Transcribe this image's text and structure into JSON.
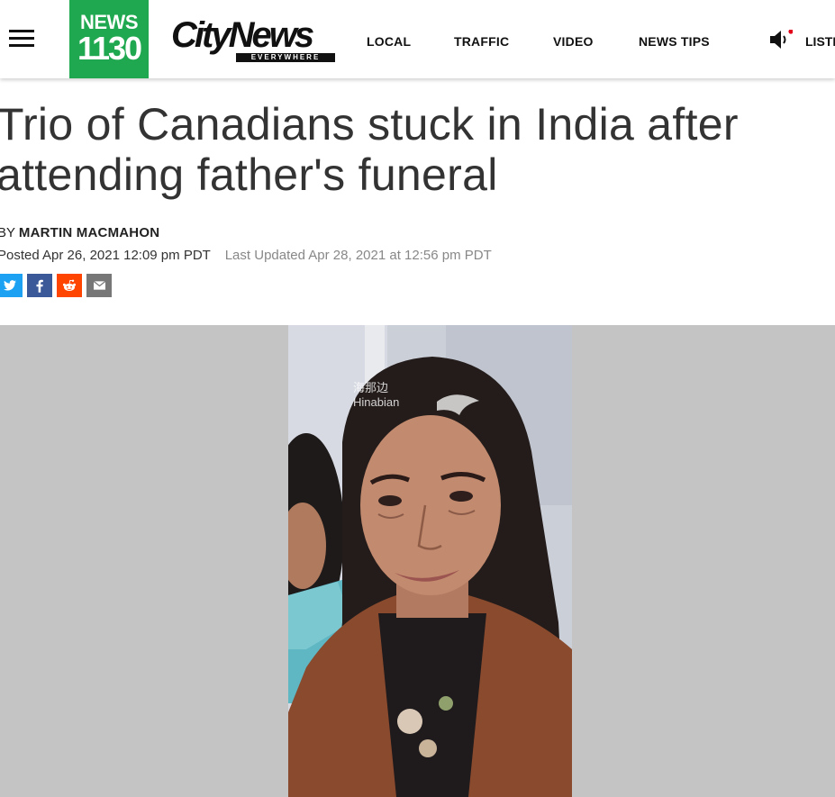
{
  "header": {
    "logo_line1": "NEWS",
    "logo_line2": "1130",
    "brand": "CityNews",
    "brand_tagline": "EVERYWHERE",
    "nav": [
      "LOCAL",
      "TRAFFIC",
      "VIDEO",
      "NEWS TIPS"
    ],
    "listen_label": "LISTE",
    "menu_icon": "hamburger-menu-icon",
    "audio_icon": "speaker-icon"
  },
  "article": {
    "headline": "Trio of Canadians stuck in India after attending father's funeral",
    "byline_prefix": "BY",
    "author": "MARTIN MACMAHON",
    "posted": "Posted Apr 26, 2021 12:09 pm PDT",
    "updated": "Last Updated Apr 28, 2021 at 12:56 pm PDT"
  },
  "share": {
    "twitter": {
      "icon": "twitter-icon",
      "color": "#1da1f2"
    },
    "facebook": {
      "icon": "facebook-icon",
      "color": "#3b5998"
    },
    "reddit": {
      "icon": "reddit-icon",
      "color": "#ff4500"
    },
    "email": {
      "icon": "email-icon",
      "color": "#777777"
    }
  },
  "photo": {
    "watermark_cn": "海那边",
    "watermark_en": "Hinabian"
  },
  "colors": {
    "brand_green": "#1fa84f",
    "photo_background": "#c4c4c4",
    "alert_dot": "#e2001a"
  }
}
